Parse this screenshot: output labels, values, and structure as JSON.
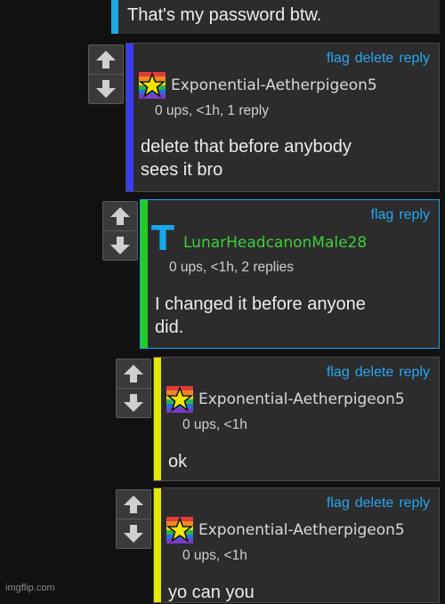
{
  "top_comment": {
    "text": "That's my password btw.",
    "accent": "#1ea7e1"
  },
  "comments": [
    {
      "id": "c1",
      "accent": "#3b3bf0",
      "actions": [
        "flag",
        "delete",
        "reply"
      ],
      "avatar": "star-rainbow-avatar",
      "username": "Exponential-Aetherpigeon5",
      "meta": "0 ups, <1h, 1 reply",
      "body": [
        "delete that before anybody",
        "sees it bro"
      ]
    },
    {
      "id": "c2",
      "accent": "#22cc22",
      "highlight": "#15aaf0",
      "actions": [
        "flag",
        "reply"
      ],
      "avatar": "letter-t-avatar",
      "avatar_text": "T",
      "username": "LunarHeadcanonMale28",
      "meta": "0 ups, <1h, 2 replies",
      "body": [
        "I changed it before anyone",
        "did."
      ]
    },
    {
      "id": "c3",
      "accent": "#e8e800",
      "actions": [
        "flag",
        "delete",
        "reply"
      ],
      "avatar": "star-rainbow-avatar",
      "username": "Exponential-Aetherpigeon5",
      "meta": "0 ups, <1h",
      "body": [
        "ok"
      ]
    },
    {
      "id": "c4",
      "accent": "#e8e800",
      "actions": [
        "flag",
        "delete",
        "reply"
      ],
      "avatar": "star-rainbow-avatar",
      "username": "Exponential-Aetherpigeon5",
      "meta": "0 ups, <1h",
      "body": [
        "yo can you"
      ]
    }
  ],
  "watermark": "imgflip.com"
}
